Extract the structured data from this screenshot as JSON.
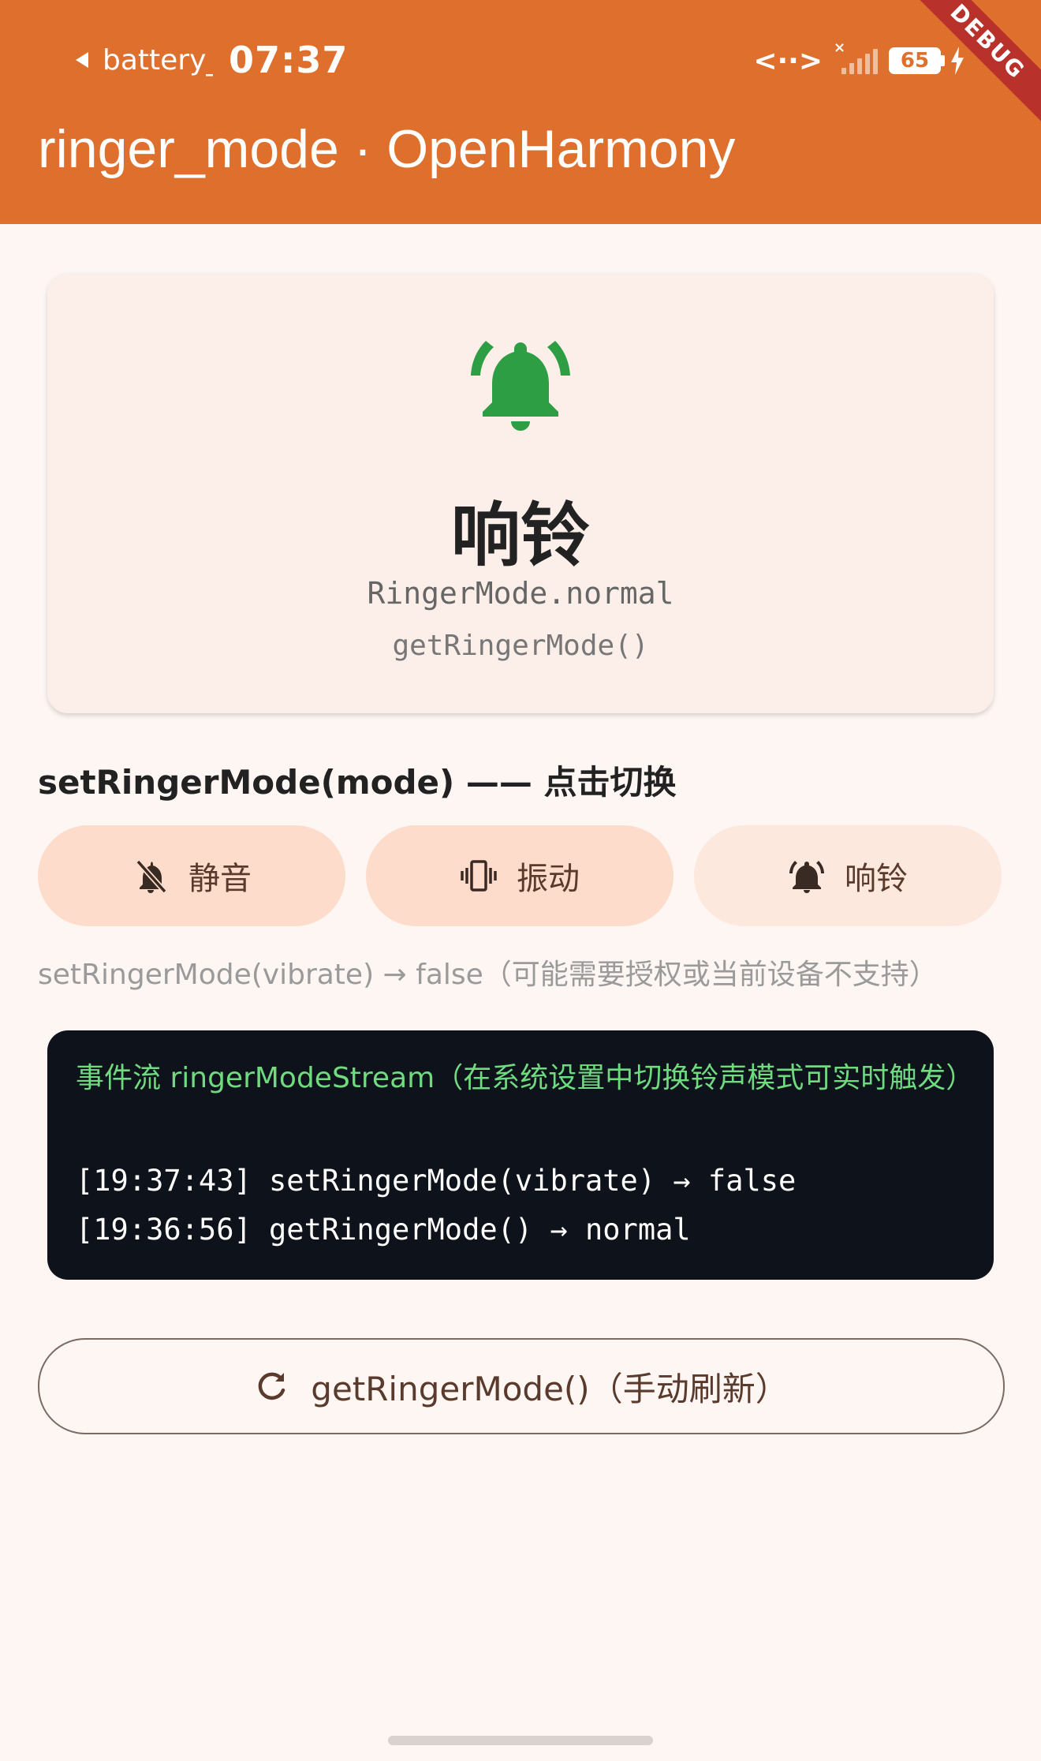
{
  "status_bar": {
    "app_name": "battery_",
    "time": "07:37",
    "network_icon": "<··>",
    "battery_level": "65",
    "debug_label": "DEBUG"
  },
  "app_bar": {
    "title": "ringer_mode · OpenHarmony"
  },
  "mode_card": {
    "icon": "bell-ringing-icon",
    "title": "响铃",
    "enum_value": "RingerMode.normal",
    "source": "getRingerMode()"
  },
  "set_section": {
    "heading": "setRingerMode(mode) —— 点击切换",
    "buttons": [
      {
        "label": "静音",
        "icon": "bell-off-icon"
      },
      {
        "label": "振动",
        "icon": "vibrate-icon"
      },
      {
        "label": "响铃",
        "icon": "bell-ringing-icon"
      }
    ],
    "result": "setRingerMode(vibrate) → false（可能需要授权或当前设备不支持）"
  },
  "event_log": {
    "title": "事件流 ringerModeStream（在系统设置中切换铃声模式可实时触发）",
    "entries": [
      "[19:37:43] setRingerMode(vibrate) → false",
      "[19:36:56] getRingerMode() → normal"
    ]
  },
  "refresh_button": {
    "label": "getRingerMode()（手动刷新）",
    "icon": "refresh-icon"
  },
  "colors": {
    "app_bar": "#de6f2c",
    "bell_green": "#2e9e44",
    "event_log_bg": "#0e121a",
    "event_title_green": "#6fda7f"
  }
}
